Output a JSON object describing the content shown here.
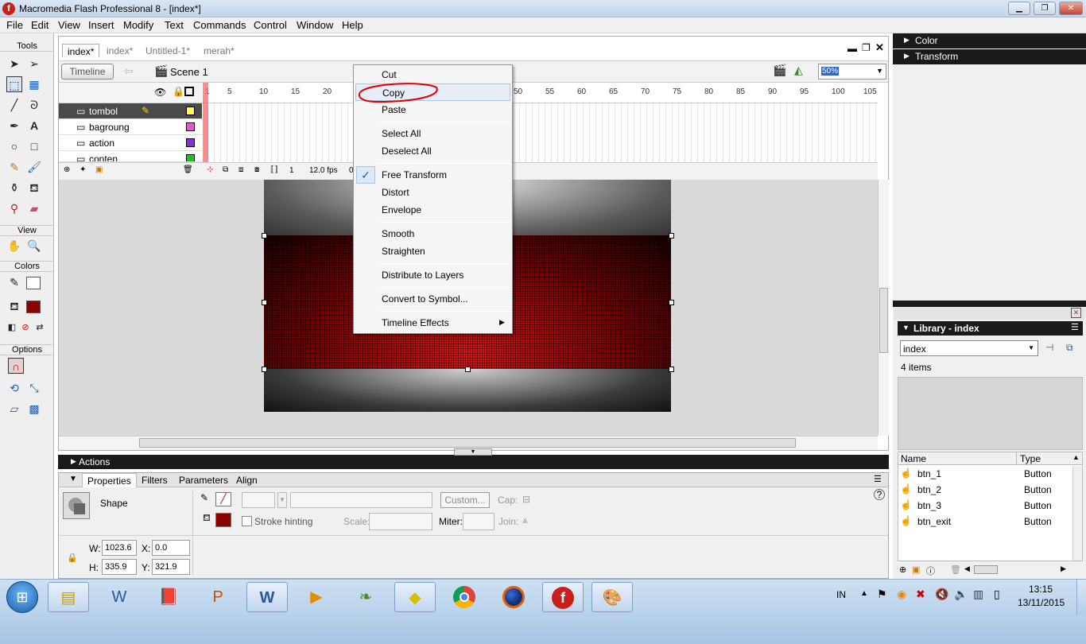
{
  "window": {
    "title": "Macromedia Flash Professional 8 - [index*]",
    "app_icon": "flash-icon"
  },
  "menu": [
    "File",
    "Edit",
    "View",
    "Insert",
    "Modify",
    "Text",
    "Commands",
    "Control",
    "Window",
    "Help"
  ],
  "toolbox": {
    "tools_label": "Tools",
    "view_label": "View",
    "colors_label": "Colors",
    "options_label": "Options"
  },
  "document": {
    "tabs": [
      "index*",
      "index*",
      "Untitled-1*",
      "merah*"
    ],
    "timeline_button": "Timeline",
    "scene": "Scene 1",
    "zoom": "50%",
    "ruler": [
      "1",
      "5",
      "10",
      "15",
      "20",
      "50",
      "55",
      "60",
      "65",
      "70",
      "75",
      "80",
      "85",
      "90",
      "95",
      "100",
      "105"
    ],
    "layers": [
      "tombol",
      "bagroung",
      "action",
      "conten"
    ],
    "frame": "1",
    "fps": "12.0 fps",
    "time": "0"
  },
  "context_menu": {
    "items": [
      "Cut",
      "Copy",
      "Paste",
      "Select All",
      "Deselect All",
      "Free Transform",
      "Distort",
      "Envelope",
      "Smooth",
      "Straighten",
      "Distribute to Layers",
      "Convert to Symbol...",
      "Timeline Effects"
    ],
    "checked": "Free Transform",
    "highlighted": "Copy"
  },
  "actions_label": "Actions",
  "properties": {
    "tabs": [
      "Properties",
      "Filters",
      "Parameters",
      "Align"
    ],
    "object_type": "Shape",
    "custom_button": "Custom...",
    "cap_label": "Cap:",
    "stroke_hinting": "Stroke hinting",
    "scale_label": "Scale:",
    "miter_label": "Miter:",
    "join_label": "Join:",
    "w_label": "W:",
    "w": "1023.6",
    "x_label": "X:",
    "x": "0.0",
    "h_label": "H:",
    "h": "335.9",
    "y_label": "Y:",
    "y": "321.9"
  },
  "right_panels": {
    "color": "Color",
    "transform": "Transform"
  },
  "library": {
    "title": "Library - index",
    "selected_doc": "index",
    "count": "4 items",
    "col_name": "Name",
    "col_type": "Type",
    "items": [
      {
        "name": "btn_1",
        "type": "Button"
      },
      {
        "name": "btn_2",
        "type": "Button"
      },
      {
        "name": "btn_3",
        "type": "Button"
      },
      {
        "name": "btn_exit",
        "type": "Button"
      }
    ]
  },
  "taskbar": {
    "apps": [
      "explorer-icon",
      "word-icon",
      "book-icon",
      "powerpoint-icon",
      "word-doc-icon",
      "media-player-icon",
      "app-icon",
      "sticky-notes-icon",
      "chrome-icon",
      "firefox-icon",
      "flash-icon",
      "paint-icon"
    ],
    "lang": "IN",
    "time": "13:15",
    "date": "13/11/2015"
  }
}
